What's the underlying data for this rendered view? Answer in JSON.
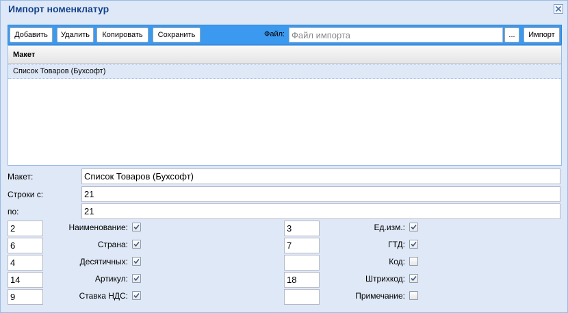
{
  "window": {
    "title": "Импорт номенклатур"
  },
  "toolbar": {
    "add_label": "Добавить",
    "delete_label": "Удалить",
    "copy_label": "Копировать",
    "save_label": "Сохранить",
    "file_label": "Файл:",
    "file_placeholder": "Файл импорта",
    "browse_label": "...",
    "import_label": "Импорт"
  },
  "grid": {
    "column_header": "Макет",
    "rows": [
      {
        "label": "Список Товаров (Бухсофт)"
      }
    ]
  },
  "form": {
    "layout_label": "Макет:",
    "layout_value": "Список Товаров (Бухсофт)",
    "rows_from_label": "Строки с:",
    "rows_from_value": "21",
    "rows_to_label": "по:",
    "rows_to_value": "21"
  },
  "mapping_left": [
    {
      "column": "2",
      "label": "Наименование:",
      "checked": true
    },
    {
      "column": "6",
      "label": "Страна:",
      "checked": true
    },
    {
      "column": "4",
      "label": "Десятичных:",
      "checked": true
    },
    {
      "column": "14",
      "label": "Артикул:",
      "checked": true
    },
    {
      "column": "9",
      "label": "Ставка НДС:",
      "checked": true
    }
  ],
  "mapping_right": [
    {
      "column": "3",
      "label": "Ед.изм.:",
      "checked": true
    },
    {
      "column": "7",
      "label": "ГТД:",
      "checked": true
    },
    {
      "column": "",
      "label": "Код:",
      "checked": false
    },
    {
      "column": "18",
      "label": "Штрихкод:",
      "checked": true
    },
    {
      "column": "",
      "label": "Примечание:",
      "checked": false
    }
  ],
  "colors": {
    "toolbar_bg": "#3b9aef",
    "window_bg": "#dfe8f6",
    "title_color": "#15428b",
    "selected_row_bg": "#dfe8f6"
  },
  "icons": {
    "close": "close-icon",
    "check": "check-icon"
  }
}
